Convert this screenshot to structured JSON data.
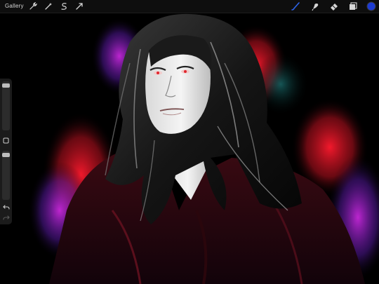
{
  "toolbar": {
    "gallery_label": "Gallery",
    "left_tools": [
      "wrench-icon",
      "magic-wand-icon",
      "selection-icon",
      "transform-arrow-icon"
    ],
    "right_tools": [
      "brush-icon",
      "smudge-icon",
      "eraser-icon",
      "layers-icon",
      "color-swatch"
    ],
    "active_tool": "brush-icon",
    "current_color": "#1d3bd1"
  },
  "sidebar": {
    "brush_size_level": 0.04,
    "brush_opacity_level": 0.05,
    "modify_button": "square-icon",
    "undo": "undo-icon",
    "redo": "redo-icon"
  },
  "canvas": {
    "background": "#000000",
    "accent_colors": [
      "#ff1a2e",
      "#c21fd6",
      "#3a2aa8",
      "#1a6a6a",
      "#3a0a14"
    ]
  }
}
